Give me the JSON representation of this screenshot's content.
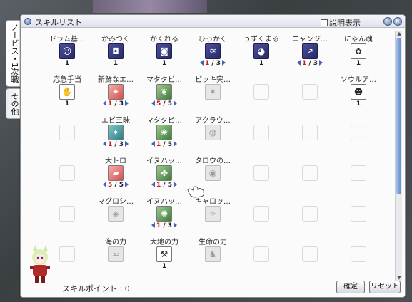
{
  "window": {
    "title": "スキルリスト",
    "description_toggle_label": "説明表示",
    "minimize_glyph": "–",
    "close_glyph": "×"
  },
  "side_tabs": [
    {
      "label": "ノービス・1次職"
    },
    {
      "label": "その他"
    }
  ],
  "skills": [
    {
      "row": 0,
      "col": 0,
      "name": "ドラム基…",
      "state": "learned",
      "icon": "cat-face-icon",
      "glyph": "☺",
      "level": "1"
    },
    {
      "row": 0,
      "col": 1,
      "name": "かみつく",
      "state": "learned",
      "icon": "bite-icon",
      "glyph": "◘",
      "level": "1"
    },
    {
      "row": 0,
      "col": 2,
      "name": "かくれる",
      "state": "learned",
      "icon": "hide-icon",
      "glyph": "◙",
      "level": "1"
    },
    {
      "row": 0,
      "col": 3,
      "name": "ひっかく",
      "state": "learned",
      "icon": "scratch-icon",
      "glyph": "≋",
      "level_cur": "1",
      "level_max": "3"
    },
    {
      "row": 0,
      "col": 4,
      "name": "うずくまる",
      "state": "learned",
      "icon": "crouch-icon",
      "glyph": "◕",
      "level": "1"
    },
    {
      "row": 0,
      "col": 5,
      "name": "ニャンジ…",
      "state": "learned",
      "icon": "jump-icon",
      "glyph": "↗",
      "level_cur": "1",
      "level_max": "3"
    },
    {
      "row": 0,
      "col": 6,
      "name": "にゃん魂",
      "state": "white",
      "icon": "soul-icon",
      "glyph": "✿",
      "level": "1"
    },
    {
      "row": 1,
      "col": 0,
      "name": "応急手当",
      "state": "white",
      "icon": "first-aid-icon",
      "glyph": "✋",
      "level": "1"
    },
    {
      "row": 1,
      "col": 1,
      "name": "新鮮なエ…",
      "state": "pink",
      "icon": "shrimp-icon",
      "glyph": "✦",
      "level_cur": "1",
      "level_max": "3"
    },
    {
      "row": 1,
      "col": 2,
      "name": "マタタビ…",
      "state": "green",
      "icon": "catnip-icon",
      "glyph": "❦",
      "level_cur": "5",
      "level_max": "5"
    },
    {
      "row": 1,
      "col": 3,
      "name": "ピッキ突…",
      "state": "dim",
      "icon": "picky-icon",
      "glyph": "✶",
      "level": ""
    },
    {
      "row": 1,
      "col": 6,
      "name": "ソウルア…",
      "state": "white",
      "icon": "soul-attack-icon",
      "glyph": "☻",
      "level": "1"
    },
    {
      "row": 2,
      "col": 1,
      "name": "エビ三昧",
      "state": "teal",
      "icon": "shrimp-party-icon",
      "glyph": "✦",
      "level_cur": "1",
      "level_max": "3"
    },
    {
      "row": 2,
      "col": 2,
      "name": "マタタビ…",
      "state": "green",
      "icon": "catnip-bomb-icon",
      "glyph": "❀",
      "level_cur": "1",
      "level_max": "5"
    },
    {
      "row": 2,
      "col": 3,
      "name": "アクラウ…",
      "state": "dim",
      "icon": "arclouse-icon",
      "glyph": "◍",
      "level": ""
    },
    {
      "row": 3,
      "col": 1,
      "name": "大トロ",
      "state": "pink",
      "icon": "tuna-icon",
      "glyph": "▰",
      "level_cur": "5",
      "level_max": "5"
    },
    {
      "row": 3,
      "col": 2,
      "name": "イヌハッ…",
      "state": "green",
      "icon": "silvervine-icon",
      "glyph": "✤",
      "level_cur": "1",
      "level_max": "5"
    },
    {
      "row": 3,
      "col": 3,
      "name": "タロウの…",
      "state": "dim",
      "icon": "tarou-icon",
      "glyph": "◉",
      "level": ""
    },
    {
      "row": 4,
      "col": 1,
      "name": "マグロシ…",
      "state": "dim",
      "icon": "tuna-shield-icon",
      "glyph": "◈",
      "level": ""
    },
    {
      "row": 4,
      "col": 2,
      "name": "イヌハッ…",
      "state": "green",
      "icon": "silvervine-root-icon",
      "glyph": "✺",
      "level_cur": "1",
      "level_max": "3"
    },
    {
      "row": 4,
      "col": 3,
      "name": "キャロッ…",
      "state": "dim",
      "icon": "carrot-icon",
      "glyph": "✧",
      "level": ""
    },
    {
      "row": 5,
      "col": 1,
      "name": "海の力",
      "state": "dim",
      "icon": "sea-power-icon",
      "glyph": "≈",
      "level": ""
    },
    {
      "row": 5,
      "col": 2,
      "name": "大地の力",
      "state": "white",
      "icon": "earth-power-icon",
      "glyph": "⚒",
      "level": "1"
    },
    {
      "row": 5,
      "col": 3,
      "name": "生命の力",
      "state": "dim",
      "icon": "life-power-icon",
      "glyph": "♞",
      "level": ""
    }
  ],
  "empty_slots": [
    [
      2,
      0
    ],
    [
      2,
      4
    ],
    [
      2,
      5
    ],
    [
      2,
      6
    ],
    [
      3,
      0
    ],
    [
      3,
      4
    ],
    [
      3,
      5
    ],
    [
      3,
      6
    ],
    [
      4,
      0
    ],
    [
      4,
      4
    ],
    [
      4,
      5
    ],
    [
      4,
      6
    ],
    [
      5,
      0
    ],
    [
      5,
      4
    ],
    [
      5,
      5
    ],
    [
      5,
      6
    ],
    [
      1,
      4
    ],
    [
      1,
      5
    ]
  ],
  "footer": {
    "skill_points_label": "スキルポイント : 0",
    "confirm_label": "確定",
    "reset_label": "リセット"
  },
  "colors": {
    "accent": "#4364b6",
    "level_current": "#d2141c",
    "learned_icon": "#33357a"
  }
}
